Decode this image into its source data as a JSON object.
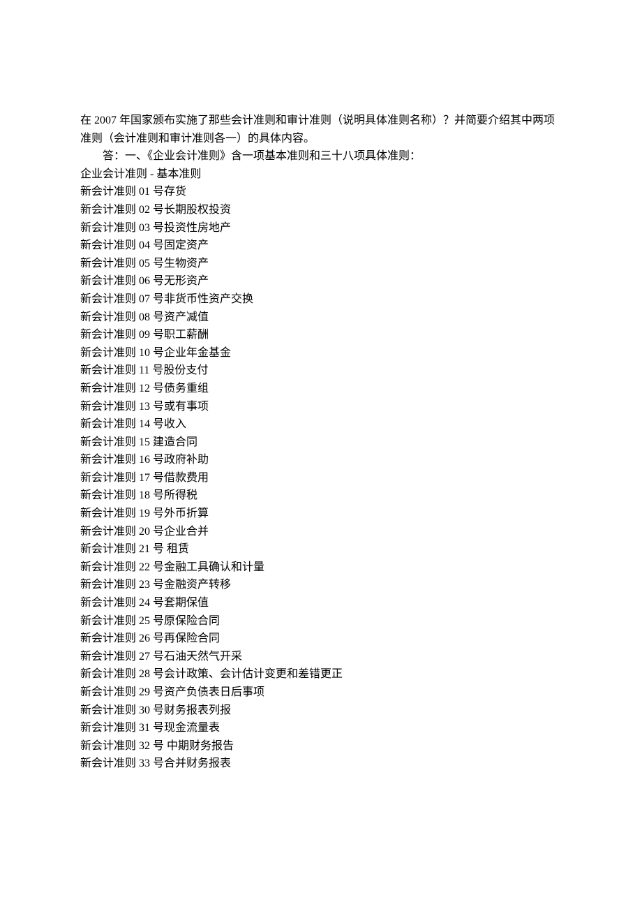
{
  "question": "在 2007 年国家颁布实施了那些会计准则和审计准则（说明具体准则名称）？并简要介绍其中两项准则（会计准则和审计准则各一）的具体内容。",
  "answer_intro": "答：一、《企业会计准则》含一项基本准则和三十八项具体准则：",
  "basic_standard": "企业会计准则 - 基本准则",
  "standards": [
    "新会计准则 01 号存货",
    "新会计准则 02 号长期股权投资",
    "新会计准则 03 号投资性房地产",
    "新会计准则 04 号固定资产",
    "新会计准则 05 号生物资产",
    "新会计准则 06 号无形资产",
    "新会计准则 07 号非货币性资产交换",
    "新会计准则 08 号资产减值",
    "新会计准则 09 号职工薪酬",
    "新会计准则 10 号企业年金基金",
    "新会计准则 11 号股份支付",
    "新会计准则 12 号债务重组",
    "新会计准则 13 号或有事项",
    "新会计准则 14 号收入",
    "新会计准则 15 建造合同",
    "新会计准则 16 号政府补助",
    "新会计准则 17 号借款费用",
    "新会计准则 18 号所得税",
    "新会计准则 19 号外币折算",
    "新会计准则 20 号企业合并",
    "新会计准则 21 号  租赁",
    "新会计准则 22 号金融工具确认和计量",
    "新会计准则 23 号金融资产转移",
    "新会计准则 24 号套期保值",
    "新会计准则 25 号原保险合同",
    "新会计准则 26 号再保险合同",
    "新会计准则 27 号石油天然气开采",
    "新会计准则 28 号会计政策、会计估计变更和差错更正",
    "新会计准则 29 号资产负债表日后事项",
    "新会计准则 30 号财务报表列报",
    "新会计准则 31 号现金流量表",
    "新会计准则 32 号  中期财务报告",
    "新会计准则 33 号合并财务报表"
  ]
}
